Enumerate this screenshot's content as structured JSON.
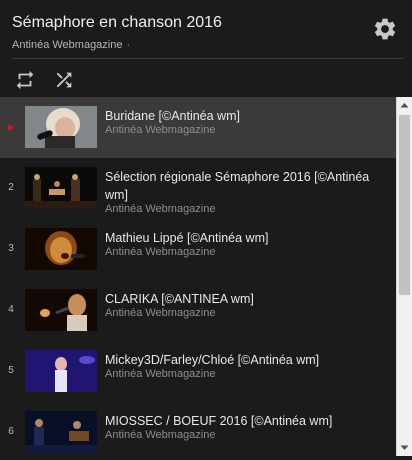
{
  "header": {
    "title": "Sémaphore en chanson 2016",
    "channel": "Antinéa Webmagazine",
    "separator_dot": "·"
  },
  "icons": {
    "settings": "gear-icon",
    "loop": "loop-icon",
    "shuffle": "shuffle-icon",
    "now_playing": "play-indicator-icon"
  },
  "colors": {
    "background": "#1b1b1b",
    "active_row": "#3a3a3a",
    "now_playing_accent": "#cc181e"
  },
  "playlist": {
    "active_index": 0,
    "items": [
      {
        "index": "▶",
        "title": "Buridane [©Antinéa wm]",
        "channel": "Antinéa Webmagazine"
      },
      {
        "index": "2",
        "title": "Sélection régionale Sémaphore 2016 [©Antinéa wm]",
        "channel": "Antinéa Webmagazine"
      },
      {
        "index": "3",
        "title": "Mathieu Lippé [©Antinéa wm]",
        "channel": "Antinéa Webmagazine"
      },
      {
        "index": "4",
        "title": "CLARIKA [©ANTINEA wm]",
        "channel": "Antinéa Webmagazine"
      },
      {
        "index": "5",
        "title": "Mickey3D/Farley/Chloé [©Antinéa wm]",
        "channel": "Antinéa Webmagazine"
      },
      {
        "index": "6",
        "title": "MIOSSEC / BOEUF 2016 [©Antinéa wm]",
        "channel": "Antinéa Webmagazine"
      }
    ]
  }
}
